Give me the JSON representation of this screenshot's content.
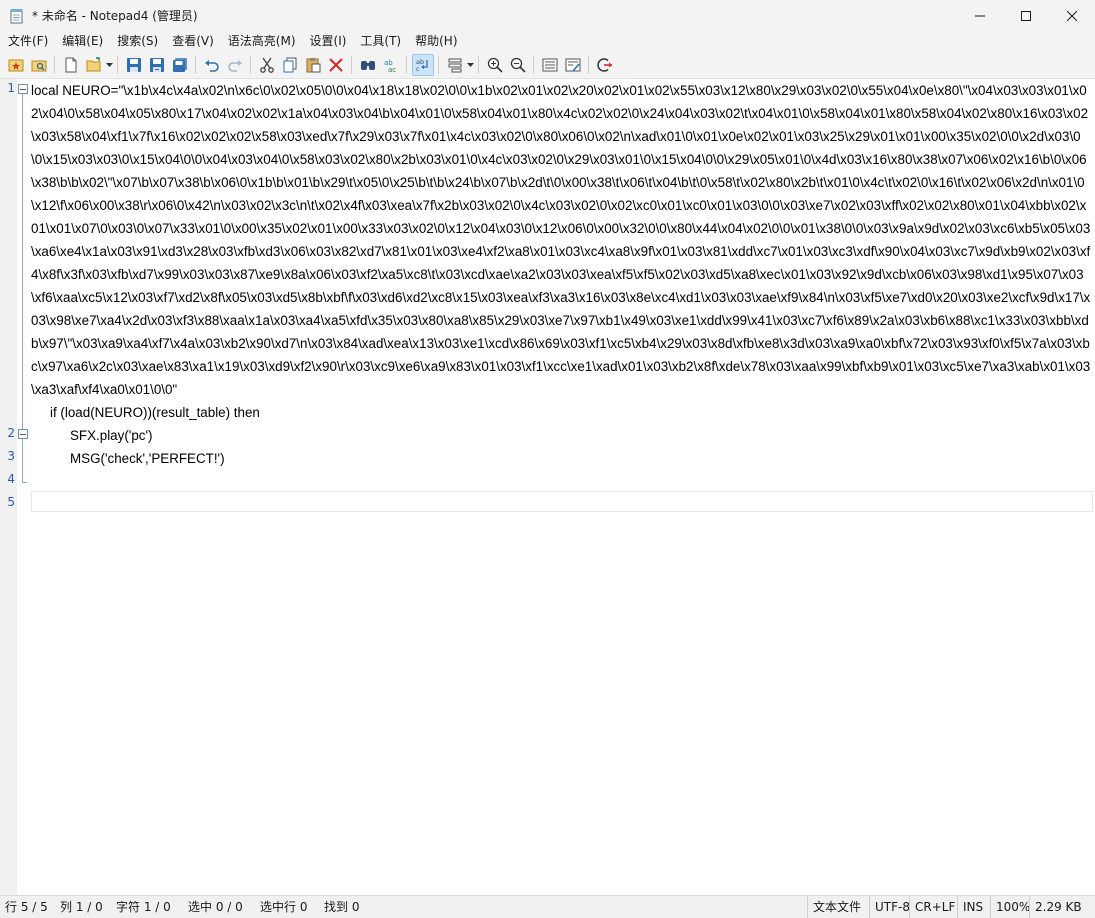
{
  "window": {
    "title": "* 未命名 - Notepad4 (管理员)",
    "icons": [
      "notepad-app-icon",
      "minimize-icon",
      "maximize-icon",
      "close-icon"
    ]
  },
  "menu": [
    "文件(F)",
    "编辑(E)",
    "搜索(S)",
    "查看(V)",
    "语法高亮(M)",
    "设置(I)",
    "工具(T)",
    "帮助(H)"
  ],
  "toolbar": {
    "icons": [
      "favorites-icon",
      "open-folder-icon",
      "new-file-icon",
      "open-file-icon",
      "dropdown-arrow-icon",
      "save-icon",
      "save-as-icon",
      "save-copy-icon",
      "undo-icon",
      "redo-icon",
      "cut-icon",
      "copy-icon",
      "paste-icon",
      "delete-icon",
      "find-icon",
      "replace-icon",
      "word-wrap-icon",
      "scheme-icon",
      "dropdown-arrow-icon",
      "zoom-in-icon",
      "zoom-out-icon",
      "settings-icon",
      "edit-settings-icon",
      "exit-icon"
    ],
    "accent_active": "#cde3f7"
  },
  "editor": {
    "line_numbers": [
      "1",
      "2",
      "3",
      "4",
      "5"
    ],
    "lines": [
      "local NEURO=\"\\x1b\\x4c\\x4a\\x02\\n\\x6c\\0\\x02\\x05\\0\\0\\x04\\x18\\x18\\x02\\0\\0\\x1b\\x02\\x01\\x02\\x20\\x02\\x01\\x02\\x55\\x03\\x12\\x80\\x29\\x03\\x02\\0\\x55\\x04\\x0e\\x80\\\"\\x04\\x03\\x03\\x01\\x02\\x04\\0\\x58\\x04\\x05\\x80\\x17\\x04\\x02\\x02\\x1a\\x04\\x03\\x04\\b\\x04\\x01\\0\\x58\\x04\\x01\\x80\\x4c\\x02\\x02\\0\\x24\\x04\\x03\\x02\\t\\x04\\x01\\0\\x58\\x04\\x01\\x80\\x58\\x04\\x02\\x80\\x16\\x03\\x02\\x03\\x58\\x04\\xf1\\x7f\\x16\\x02\\x02\\x02\\x58\\x03\\xed\\x7f\\x29\\x03\\x7f\\x01\\x4c\\x03\\x02\\0\\x80\\x06\\0\\x02\\n\\xad\\x01\\0\\x01\\x0e\\x02\\x01\\x03\\x25\\x29\\x01\\x01\\x00\\x35\\x02\\0\\0\\x2d\\x03\\0\\0\\x15\\x03\\x03\\0\\x15\\x04\\0\\0\\x04\\x03\\x04\\0\\x58\\x03\\x02\\x80\\x2b\\x03\\x01\\0\\x4c\\x03\\x02\\0\\x29\\x03\\x01\\0\\x15\\x04\\0\\0\\x29\\x05\\x01\\0\\x4d\\x03\\x16\\x80\\x38\\x07\\x06\\x02\\x16\\b\\0\\x06\\x38\\b\\b\\x02\\\"\\x07\\b\\x07\\x38\\b\\x06\\0\\x1b\\b\\x01\\b\\x29\\t\\x05\\0\\x25\\b\\t\\b\\x24\\b\\x07\\b\\x2d\\t\\0\\x00\\x38\\t\\x06\\t\\x04\\b\\t\\0\\x58\\t\\x02\\x80\\x2b\\t\\x01\\0\\x4c\\t\\x02\\0\\x16\\t\\x02\\x06\\x2d\\n\\x01\\0\\x12\\f\\x06\\x00\\x38\\r\\x06\\0\\x42\\n\\x03\\x02\\x3c\\n\\t\\x02\\x4f\\x03\\xea\\x7f\\x2b\\x03\\x02\\0\\x4c\\x03\\x02\\0\\x02\\xc0\\x01\\xc0\\x01\\x03\\0\\0\\x03\\xe7\\x02\\x03\\xff\\x02\\x02\\x80\\x01\\x04\\xbb\\x02\\x01\\x01\\x07\\0\\x03\\0\\x07\\x33\\x01\\0\\x00\\x35\\x02\\x01\\x00\\x33\\x03\\x02\\0\\x12\\x04\\x03\\0\\x12\\x06\\0\\x00\\x32\\0\\0\\x80\\x44\\x04\\x02\\0\\0\\x01\\x38\\0\\0\\x03\\x9a\\x9d\\x02\\x03\\xc6\\xb5\\x05\\x03\\xa6\\xe4\\x1a\\x03\\x91\\xd3\\x28\\x03\\xfb\\xd3\\x06\\x03\\x82\\xd7\\x81\\x01\\x03\\xe4\\xf2\\xa8\\x01\\x03\\xc4\\xa8\\x9f\\x01\\x03\\x81\\xdd\\xc7\\x01\\x03\\xc3\\xdf\\x90\\x04\\x03\\xc7\\x9d\\xb9\\x02\\x03\\xf4\\x8f\\x3f\\x03\\xfb\\xd7\\x99\\x03\\x03\\x87\\xe9\\x8a\\x06\\x03\\xf2\\xa5\\xc8\\t\\x03\\xcd\\xae\\xa2\\x03\\x03\\xea\\xf5\\xf5\\x02\\x03\\xd5\\xa8\\xec\\x01\\x03\\x92\\x9d\\xcb\\x06\\x03\\x98\\xd1\\x95\\x07\\x03\\xf6\\xaa\\xc5\\x12\\x03\\xf7\\xd2\\x8f\\x05\\x03\\xd5\\x8b\\xbf\\f\\x03\\xd6\\xd2\\xc8\\x15\\x03\\xea\\xf3\\xa3\\x16\\x03\\x8e\\xc4\\xd1\\x03\\x03\\xae\\xf9\\x84\\n\\x03\\xf5\\xe7\\xd0\\x20\\x03\\xe2\\xcf\\x9d\\x17\\x03\\x98\\xe7\\xa4\\x2d\\x03\\xf3\\x88\\xaa\\x1a\\x03\\xa4\\xa5\\xfd\\x35\\x03\\x80\\xa8\\x85\\x29\\x03\\xe7\\x97\\xb1\\x49\\x03\\xe1\\xdd\\x99\\x41\\x03\\xc7\\xf6\\x89\\x2a\\x03\\xb6\\x88\\xc1\\x33\\x03\\xbb\\xdb\\x97\\\"\\x03\\xa9\\xa4\\xf7\\x4a\\x03\\xb2\\x90\\xd7\\n\\x03\\x84\\xad\\xea\\x13\\x03\\xe1\\xcd\\x86\\x69\\x03\\xf1\\xc5\\xb4\\x29\\x03\\x8d\\xfb\\xe8\\x3d\\x03\\xa9\\xa0\\xbf\\x72\\x03\\x93\\xf0\\xf5\\x7a\\x03\\xbc\\x97\\xa6\\x2c\\x03\\xae\\x83\\xa1\\x19\\x03\\xd9\\xf2\\x90\\r\\x03\\xc9\\xe6\\xa9\\x83\\x01\\x03\\xf1\\xcc\\xe1\\xad\\x01\\x03\\xb2\\x8f\\xde\\x78\\x03\\xaa\\x99\\xbf\\xb9\\x01\\x03\\xc5\\xe7\\xa3\\xab\\x01\\x03\\xa3\\xaf\\xf4\\xa0\\x01\\0\\0\"",
      "if (load(NEURO))(result_table) then",
      "SFX.play('pc')",
      "MSG('check','PERFECT!')",
      ""
    ]
  },
  "status": {
    "line": "行 5 / 5",
    "col": "列 1 / 0",
    "char": "字符 1 / 0",
    "sel": "选中 0 / 0",
    "sel_lines": "选中行 0",
    "found": "找到 0",
    "file_type": "文本文件",
    "encoding": "UTF-8",
    "eol": "CR+LF",
    "ins": "INS",
    "zoom": "100%",
    "size": "2.29 KB"
  }
}
